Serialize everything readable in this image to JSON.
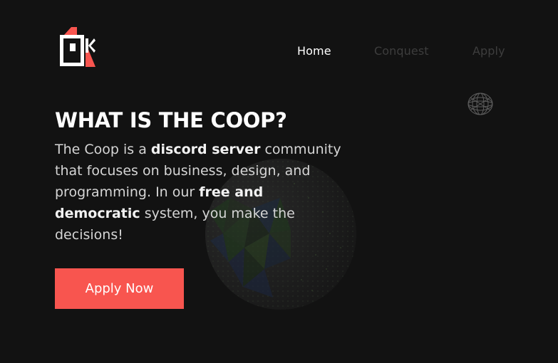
{
  "brand": {
    "logo_icon": "coop-logo-icon",
    "colors": {
      "accent": "#f8554f",
      "background": "#121212",
      "text": "#ffffff",
      "muted_nav": "#3d3d3d"
    }
  },
  "nav": {
    "items": [
      {
        "label": "Home",
        "active": true
      },
      {
        "label": "Conquest",
        "active": false
      },
      {
        "label": "Apply",
        "active": false
      }
    ]
  },
  "hero": {
    "title": "WHAT IS THE COOP?",
    "description": {
      "part1": "The Coop is a ",
      "bold1": "discord server",
      "part2": " community that focuses on business, design, and programming. In our ",
      "bold2": "free and democratic",
      "part3": " system, you make the decisions!"
    },
    "cta_label": "Apply Now"
  },
  "decor": {
    "globe_icon": "globe-icon",
    "small_globe_icon": "wireframe-globe-icon"
  }
}
